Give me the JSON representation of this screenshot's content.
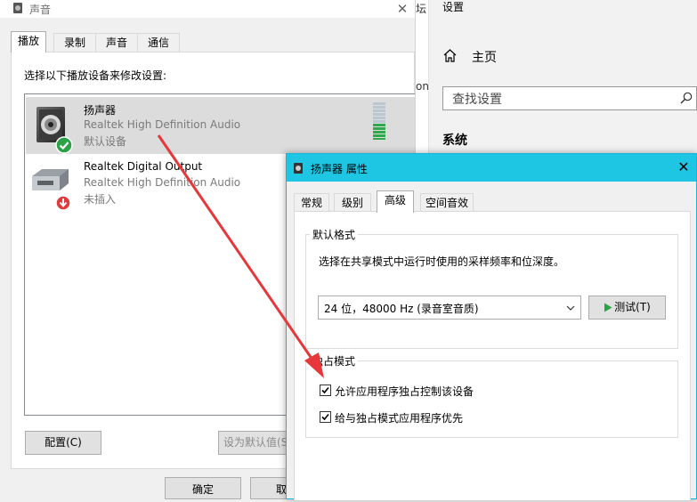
{
  "sound_dialog": {
    "title": "声音",
    "close_symbol": "✕",
    "tabs": [
      {
        "label": "播放"
      },
      {
        "label": "录制"
      },
      {
        "label": "声音"
      },
      {
        "label": "通信"
      }
    ],
    "instruction": "选择以下播放设备来修改设置:",
    "devices": [
      {
        "name": "扬声器",
        "driver": "Realtek High Definition Audio",
        "status": "默认设备",
        "icon": "speaker-icon",
        "badge": "default-check-icon"
      },
      {
        "name": "Realtek Digital Output",
        "driver": "Realtek High Definition Audio",
        "status": "未插入",
        "icon": "digital-output-icon",
        "badge": "unplugged-arrow-icon"
      }
    ],
    "buttons": {
      "configure": "配置(C)",
      "set_default": "设为默认值(S",
      "ok": "确定",
      "cancel": "取"
    }
  },
  "middle_window": {
    "text_top": "坛",
    "text_mid": "on"
  },
  "settings": {
    "title": "设置",
    "home_label": "主页",
    "search_placeholder": "查找设置",
    "section_label": "系统"
  },
  "properties_dialog": {
    "title": "扬声器 属性",
    "close_symbol": "✕",
    "tabs": [
      {
        "label": "常规"
      },
      {
        "label": "级别"
      },
      {
        "label": "高级"
      },
      {
        "label": "空间音效"
      }
    ],
    "default_format": {
      "group_label": "默认格式",
      "description": "选择在共享模式中运行时使用的采样频率和位深度。",
      "selected_format": "24 位，48000 Hz (录音室音质)",
      "test_button": "测试(T)"
    },
    "exclusive_mode": {
      "group_label": "独占模式",
      "options": [
        {
          "label": "允许应用程序独占控制该设备",
          "checked": true
        },
        {
          "label": "给与独占模式应用程序优先",
          "checked": true
        }
      ]
    }
  },
  "colors": {
    "title_bar_accent": "#1ec6e3",
    "selected_device_bg": "#dcdcdc",
    "annotation_arrow": "#e8373a",
    "default_badge": "#2aa245",
    "level_meter": "#2ea84a"
  }
}
